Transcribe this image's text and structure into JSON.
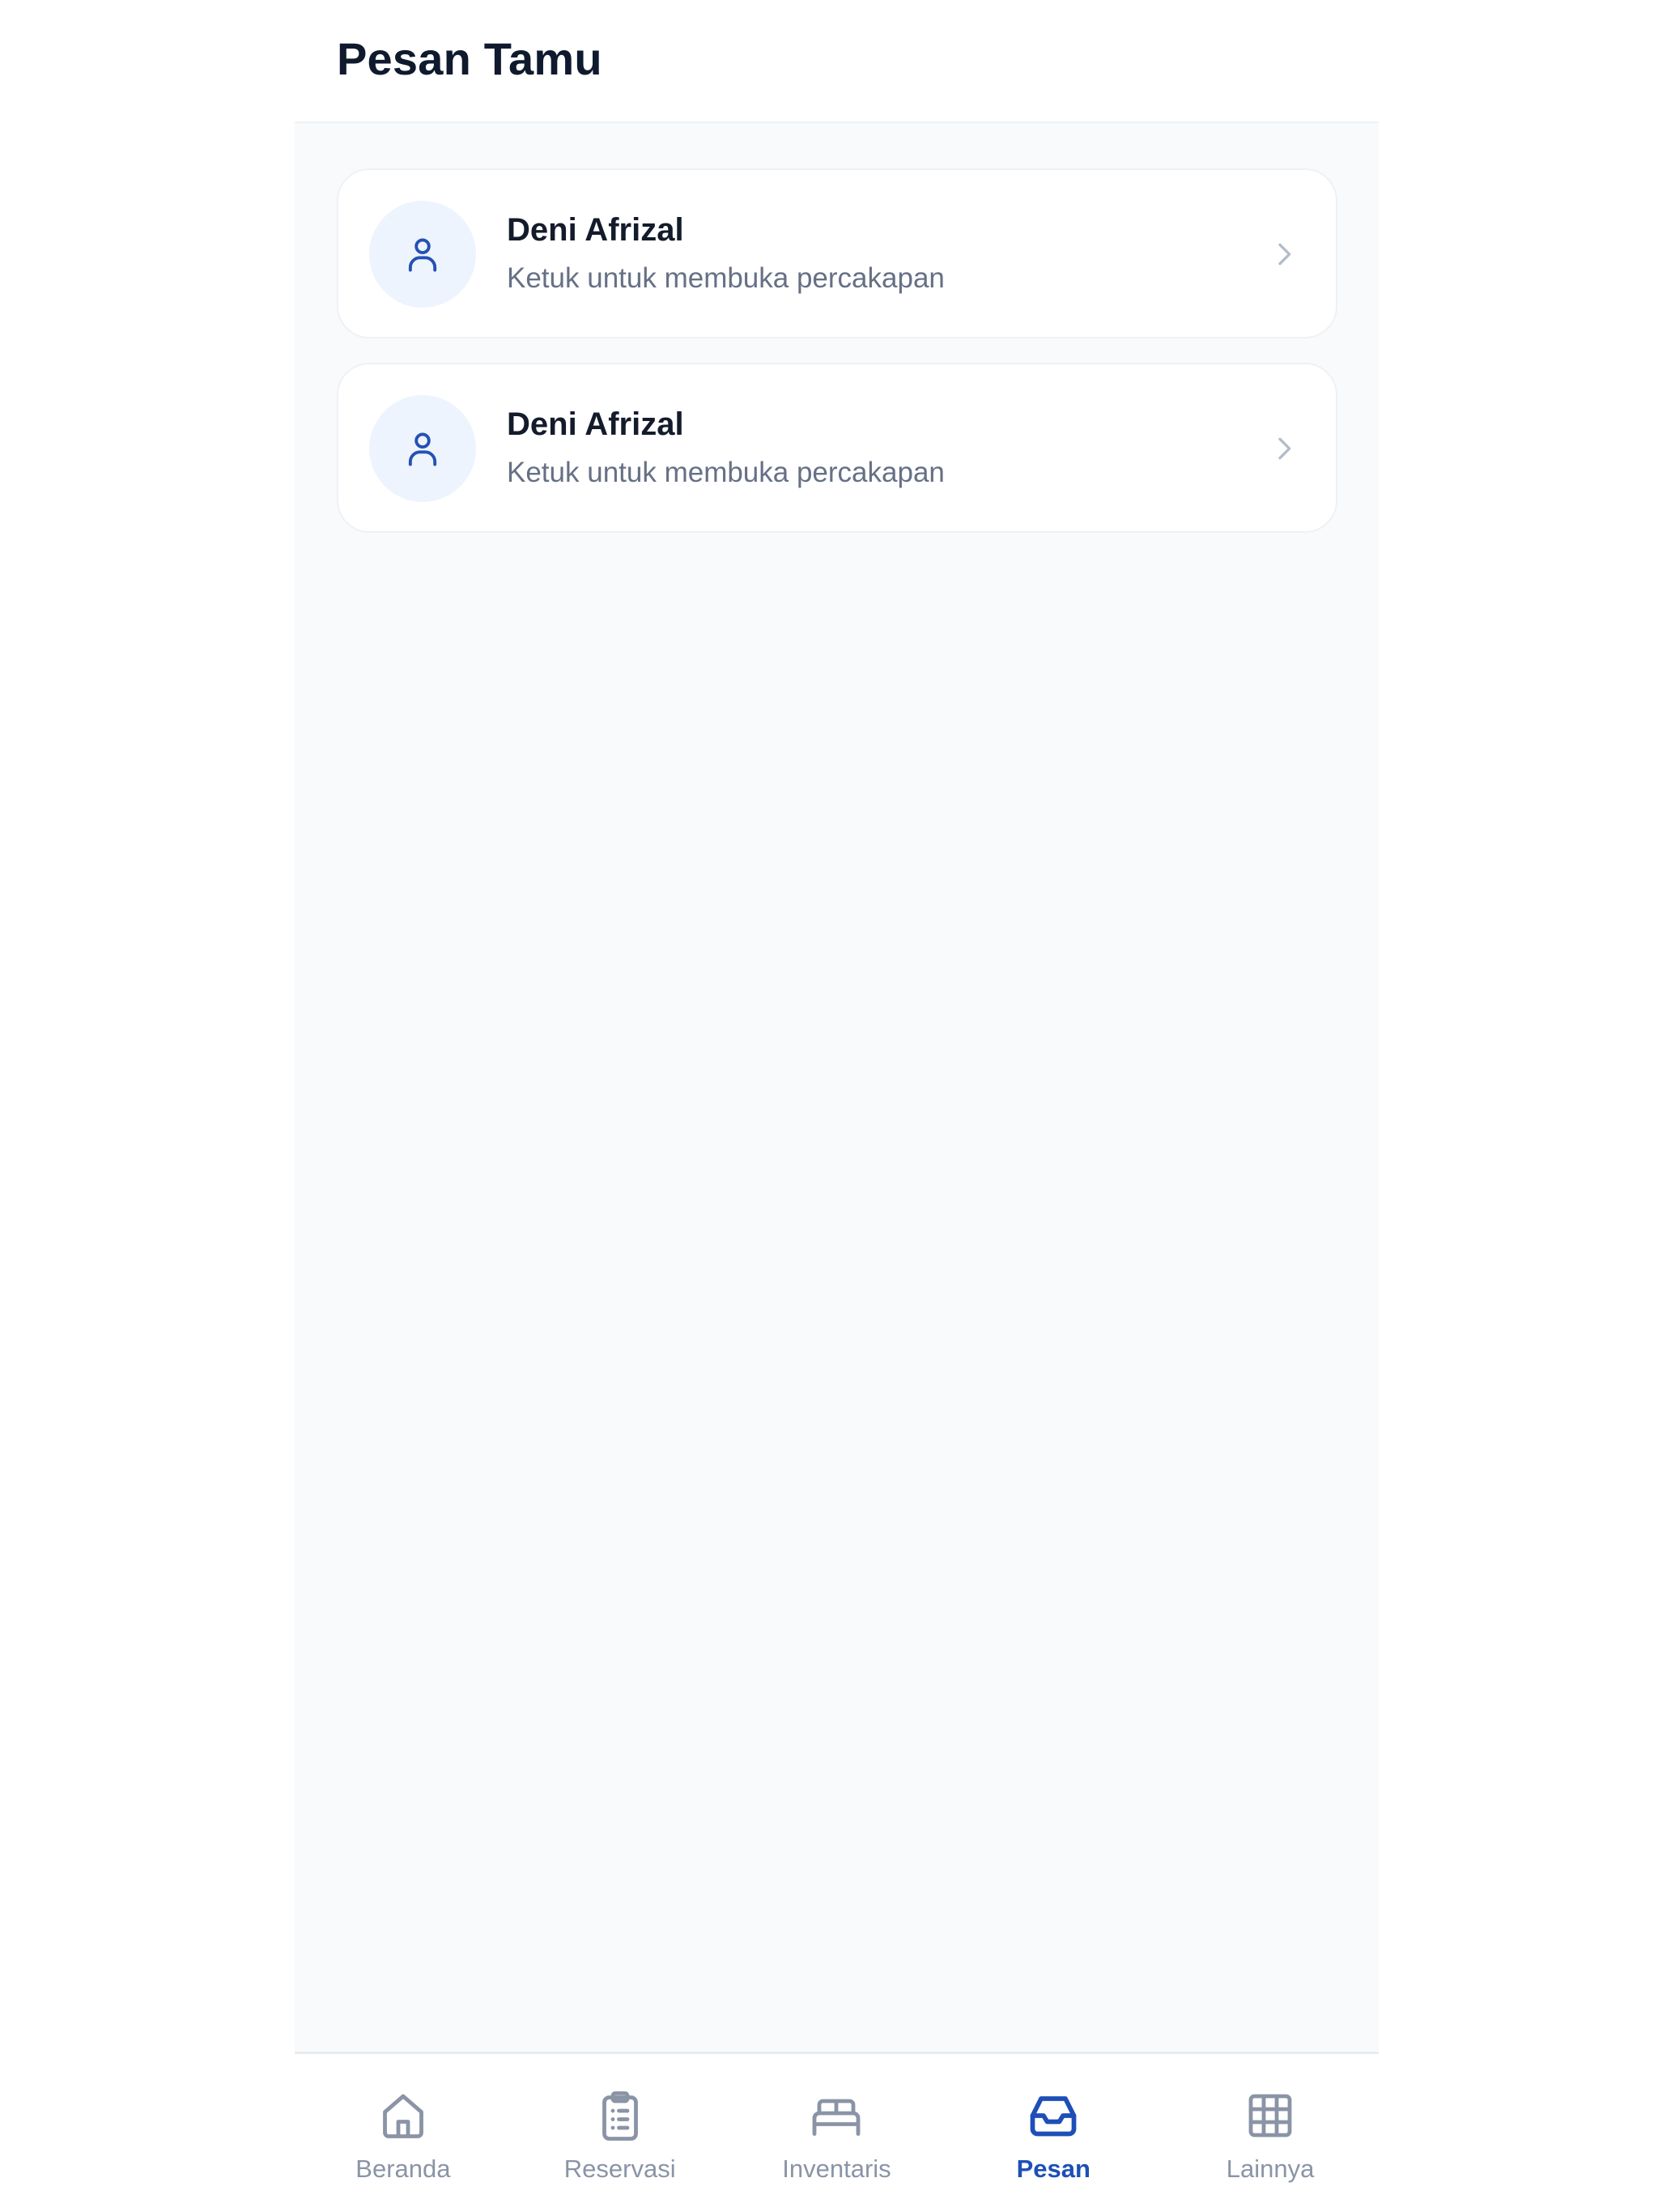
{
  "header": {
    "title": "Pesan Tamu"
  },
  "conversations": [
    {
      "name": "Deni Afrizal",
      "subtitle": "Ketuk untuk membuka percakapan",
      "icon": "user-icon"
    },
    {
      "name": "Deni Afrizal",
      "subtitle": "Ketuk untuk membuka percakapan",
      "icon": "user-icon"
    }
  ],
  "bottom_nav": {
    "items": [
      {
        "label": "Beranda",
        "icon": "home-icon",
        "active": false
      },
      {
        "label": "Reservasi",
        "icon": "clipboard-list-icon",
        "active": false
      },
      {
        "label": "Inventaris",
        "icon": "bed-icon",
        "active": false
      },
      {
        "label": "Pesan",
        "icon": "inbox-icon",
        "active": true
      },
      {
        "label": "Lainnya",
        "icon": "grid-icon",
        "active": false
      }
    ]
  },
  "colors": {
    "accent": "#1e4fb8",
    "inactive": "#8a94a6",
    "title": "#0f1a2e",
    "background": "#f8fafc"
  }
}
